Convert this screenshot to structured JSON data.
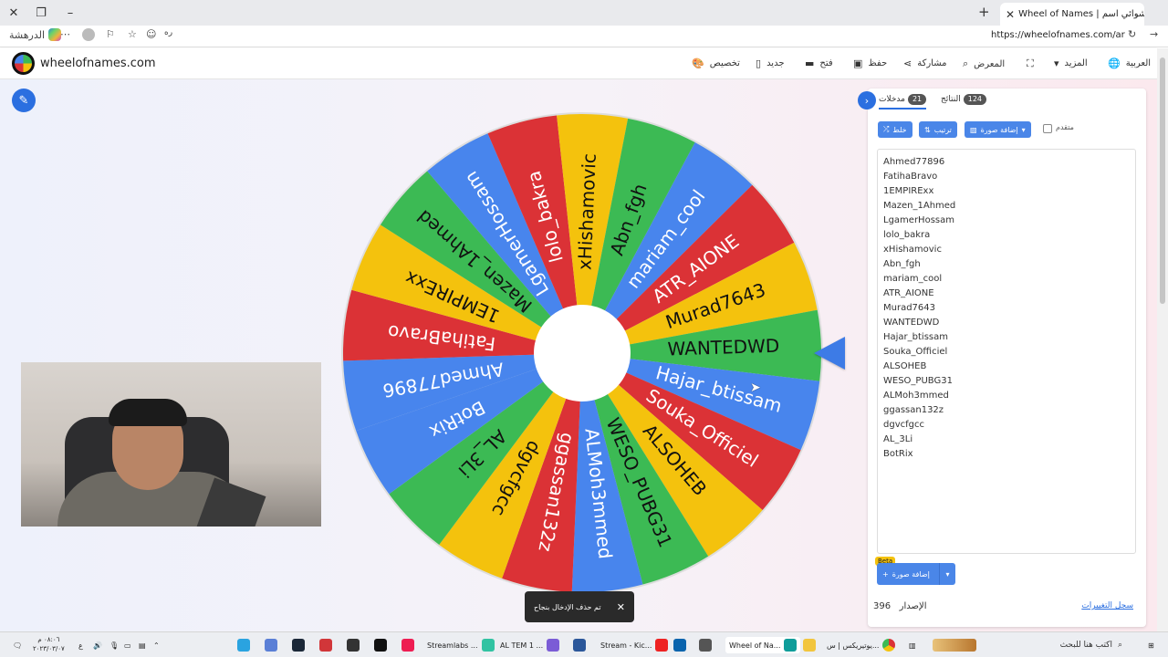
{
  "browser": {
    "tab_title": "Wheel of Names | ‫العشوائي اسم",
    "url": "https://wheelofnames.com/ar",
    "favorites_label": "الدرهشة",
    "address_glyph": "ره"
  },
  "site": {
    "logo_text": "wheelofnames.com",
    "nav": {
      "customize": "تخصيص",
      "new": "جديد",
      "open": "فتح",
      "save": "حفظ",
      "share": "مشاركة",
      "gallery": "المعرض",
      "more": "المزيد",
      "language": "العربية"
    }
  },
  "wheel": {
    "entries": [
      "Ahmed77896",
      "FatihaBravo",
      "1EMPIRExx",
      "Mazen_1Ahmed",
      "LgamerHossam",
      "lolo_bakra",
      "xHishamovic",
      "Abn_fgh",
      "mariam_cool",
      "ATR_AIONE",
      "Murad7643",
      "WANTEDWD",
      "Hajar_btissam",
      "Souka_Officiel",
      "ALSOHEB",
      "WESO_PUBG31",
      "ALMoh3mmed",
      "ggassan132z",
      "dgvcfgcc",
      "AL_3Li",
      "BotRix"
    ],
    "colors": {
      "red": "#db3236",
      "blue": "#4885ed",
      "green": "#3cba54",
      "yellow": "#f4c20d"
    }
  },
  "panel": {
    "tab_entries_label": "مدخلات",
    "tab_entries_count": "21",
    "tab_results_label": "النتائج",
    "tab_results_count": "124",
    "shuffle_label": "خلط",
    "sort_label": "ترتيب",
    "add_image_label": "إضافة صورة",
    "advanced_label": "متقدم",
    "add_entry_label": "إضافة صورة",
    "beta_label": "Beta",
    "version_label": "الإصدار",
    "version_number": "396",
    "changelog_label": "سجل التغييرات"
  },
  "toast": {
    "message": "تم حذف الإدخال بنجاح"
  },
  "taskbar": {
    "search_placeholder": "اكتب هنا للبحث",
    "items": [
      "يوتيريكس | س...",
      "Wheel of Na...",
      "Stream - Kic...",
      "AL TEM 1 ...",
      "Streamlabs ..."
    ],
    "clock_time": "٠٨:٠٦ م",
    "clock_date": "٢٠٢٣/٠٣/٠٧",
    "lang": "ع"
  }
}
